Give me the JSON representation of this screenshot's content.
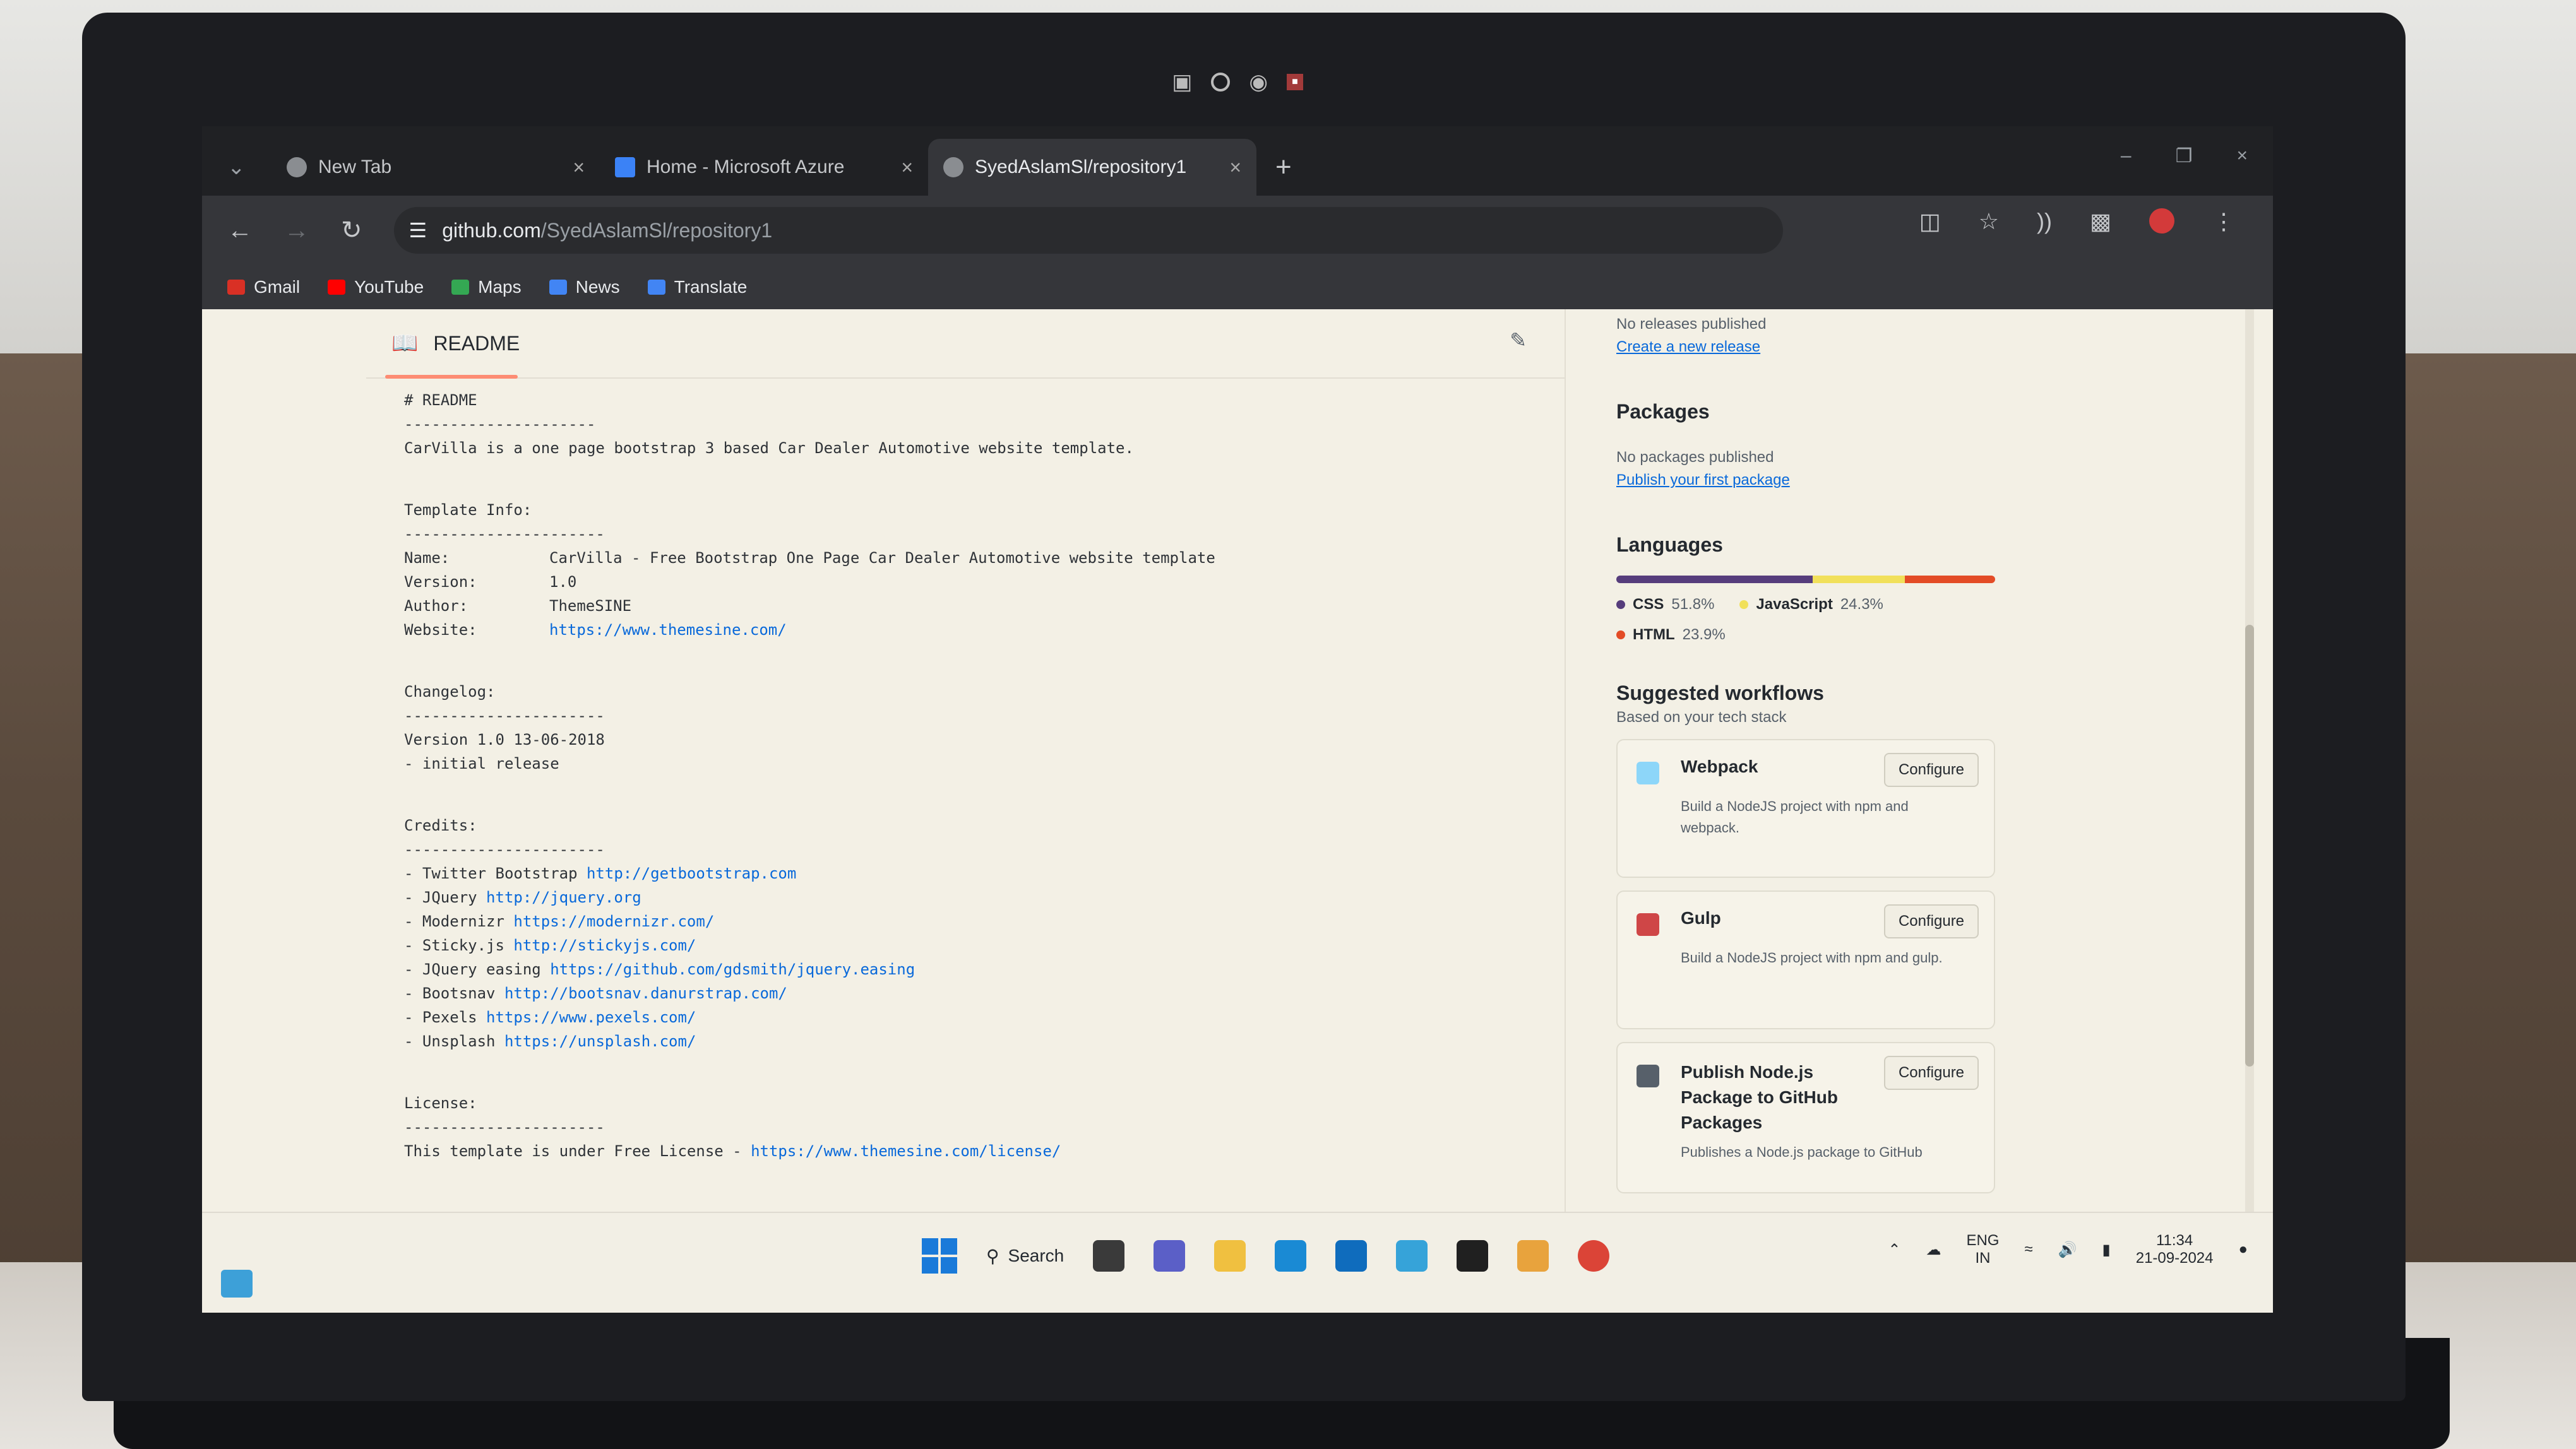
{
  "browser": {
    "tabs": [
      {
        "title": "New Tab",
        "active": false,
        "favicon": "chrome-icon"
      },
      {
        "title": "Home - Microsoft Azure",
        "active": false,
        "favicon": "azure-icon"
      },
      {
        "title": "SyedAslamSl/repository1",
        "active": true,
        "favicon": "github-icon"
      }
    ],
    "new_tab": "+",
    "url_host": "github.com",
    "url_path": "/SyedAslamSl/repository1",
    "bookmarks": [
      {
        "label": "Gmail",
        "color": "#d93025"
      },
      {
        "label": "YouTube",
        "color": "#ff0000"
      },
      {
        "label": "Maps",
        "color": "#34a853"
      },
      {
        "label": "News",
        "color": "#4285f4"
      },
      {
        "label": "Translate",
        "color": "#4285f4"
      }
    ]
  },
  "readme": {
    "title": "README",
    "lines": {
      "h": "# README",
      "r1": "---------------------",
      "intro": "CarVilla is a one page bootstrap 3 based Car Dealer Automotive website template.",
      "info_h": "Template Info:",
      "r2": "----------------------",
      "name_k": "Name:",
      "name_v": "CarVilla - Free Bootstrap One Page Car Dealer Automotive website template",
      "version_k": "Version:",
      "version_v": "1.0",
      "author_k": "Author:",
      "author_v": "ThemeSINE",
      "website_k": "Website:",
      "website_v": "https://www.themesine.com/",
      "changelog_h": "Changelog:",
      "r3": "----------------------",
      "cl1": "Version 1.0 13-06-2018",
      "cl2": "- initial release",
      "credits_h": "Credits:",
      "r4": "----------------------",
      "c1a": "- Twitter Bootstrap ",
      "c1b": "http://getbootstrap.com",
      "c2a": "- JQuery ",
      "c2b": "http://jquery.org",
      "c3a": "- Modernizr ",
      "c3b": "https://modernizr.com/",
      "c4a": "- Sticky.js ",
      "c4b": "http://stickyjs.com/",
      "c5a": "- JQuery easing ",
      "c5b": "https://github.com/gdsmith/jquery.easing",
      "c6a": "- Bootsnav ",
      "c6b": "http://bootsnav.danurstrap.com/",
      "c7a": "- Pexels ",
      "c7b": "https://www.pexels.com/",
      "c8a": "- Unsplash ",
      "c8b": "https://unsplash.com/",
      "license_h": "License:",
      "r5": "----------------------",
      "lic_a": "This template is under Free License - ",
      "lic_b": "https://www.themesine.com/license/"
    }
  },
  "sidebar": {
    "releases_text": "No releases published",
    "releases_link": "Create a new release",
    "packages_h": "Packages",
    "packages_text": "No packages published",
    "packages_link": "Publish your first package",
    "languages_h": "Languages",
    "languages": [
      {
        "name": "CSS",
        "pct": "51.8%",
        "value": 51.8,
        "color": "#563d7c"
      },
      {
        "name": "JavaScript",
        "pct": "24.3%",
        "value": 24.3,
        "color": "#f1e05a"
      },
      {
        "name": "HTML",
        "pct": "23.9%",
        "value": 23.9,
        "color": "#e34c26"
      }
    ],
    "workflows_h": "Suggested workflows",
    "workflows_sub": "Based on your tech stack",
    "workflows": [
      {
        "title": "Webpack",
        "desc": "Build a NodeJS project with npm and webpack.",
        "button": "Configure",
        "icon": "webpack-icon",
        "color": "#8dd6f9"
      },
      {
        "title": "Gulp",
        "desc": "Build a NodeJS project with npm and gulp.",
        "button": "Configure",
        "icon": "gulp-icon",
        "color": "#cf4647"
      },
      {
        "title": "Publish Node.js Package to GitHub Packages",
        "desc": "Publishes a Node.js package to GitHub",
        "button": "Configure",
        "icon": "package-icon",
        "color": "#57606a"
      }
    ]
  },
  "taskbar": {
    "search_label": "Search",
    "lang_top": "ENG",
    "lang_bottom": "IN",
    "time": "11:34",
    "date": "21-09-2024"
  }
}
